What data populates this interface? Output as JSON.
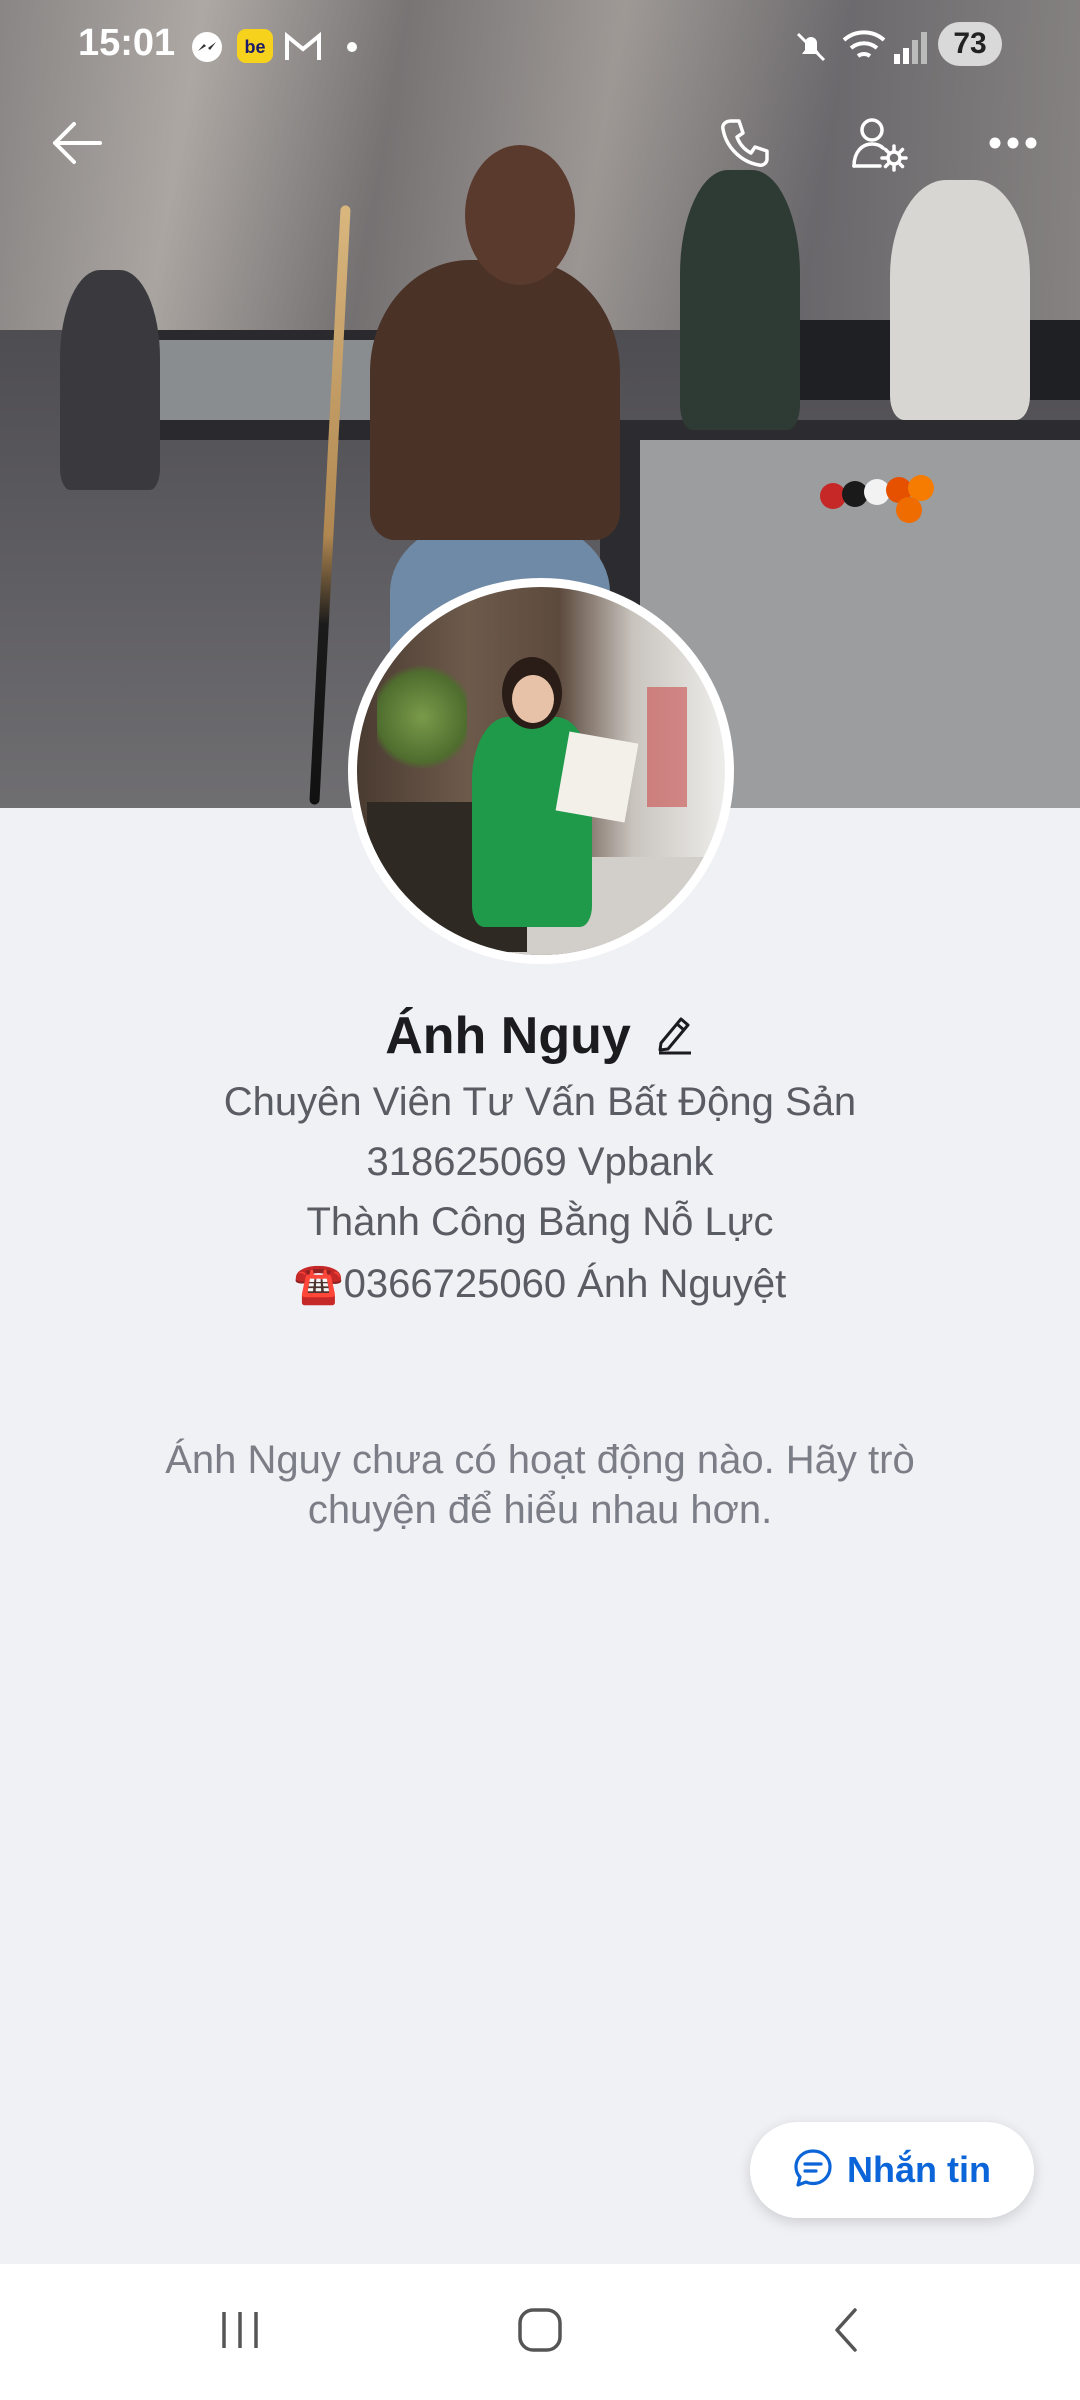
{
  "status_bar": {
    "time": "15:01",
    "battery": "73",
    "notification_icons": [
      "messenger-icon",
      "be-app-icon",
      "gmail-icon",
      "dot-icon"
    ],
    "system_icons": [
      "mute-icon",
      "wifi-icon",
      "signal-icon"
    ]
  },
  "header": {
    "back_icon": "back-arrow-icon",
    "call_icon": "phone-icon",
    "settings_icon": "user-settings-icon",
    "more_icon": "more-dots-icon"
  },
  "profile": {
    "name": "Ánh Nguy",
    "bio_lines": [
      "Chuyên Viên Tư Vấn Bất Động Sản",
      "318625069 Vpbank",
      "Thành Công Bằng Nỗ Lực",
      "☎️0366725060 Ánh Nguyệt"
    ]
  },
  "empty_state": {
    "line1": "Ánh Nguy chưa có hoạt động nào. Hãy trò",
    "line2": "chuyện để hiểu nhau hơn."
  },
  "message_button": {
    "label": "Nhắn tin"
  },
  "colors": {
    "accent": "#0b65d8",
    "background": "#f0f1f5"
  }
}
